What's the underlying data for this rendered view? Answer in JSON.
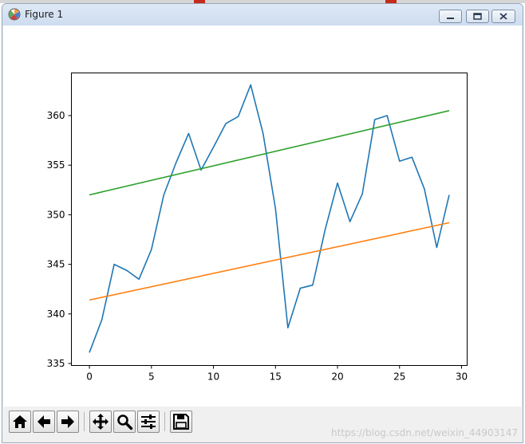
{
  "window": {
    "title": "Figure 1",
    "icon": "matplotlib-figure-icon",
    "controls": [
      {
        "name": "minimize-button",
        "icon": "minimize-icon"
      },
      {
        "name": "restore-button",
        "icon": "restore-icon"
      },
      {
        "name": "close-button",
        "icon": "close-icon"
      }
    ]
  },
  "toolbar": {
    "buttons": [
      {
        "name": "home-button",
        "icon": "home-icon"
      },
      {
        "name": "back-button",
        "icon": "arrow-left-icon"
      },
      {
        "name": "forward-button",
        "icon": "arrow-right-icon"
      },
      {
        "name": "pan-button",
        "icon": "move-icon"
      },
      {
        "name": "zoom-button",
        "icon": "magnifier-icon"
      },
      {
        "name": "configure-subplots-button",
        "icon": "sliders-icon"
      },
      {
        "name": "save-button",
        "icon": "floppy-disk-icon"
      }
    ],
    "watermark": "https://blog.csdn.net/weixin_44903147"
  },
  "colors": {
    "series_blue": "#1f77b4",
    "series_orange": "#ff7f0e",
    "series_green": "#2ca02c"
  },
  "chart_data": {
    "type": "line",
    "title": "",
    "xlabel": "",
    "ylabel": "",
    "xlim": [
      -1.45,
      30.45
    ],
    "ylim": [
      334.8,
      364.3
    ],
    "xticks": [
      0,
      5,
      10,
      15,
      20,
      25,
      30
    ],
    "yticks": [
      335,
      340,
      345,
      350,
      355,
      360
    ],
    "grid": false,
    "legend": "none",
    "series": [
      {
        "color": "#1f77b4",
        "x": [
          0,
          1,
          2,
          3,
          4,
          5,
          6,
          7,
          8,
          9,
          10,
          11,
          12,
          13,
          14,
          15,
          16,
          17,
          18,
          19,
          20,
          21,
          22,
          23,
          24,
          25,
          26,
          27,
          28,
          29
        ],
        "y": [
          336.1,
          339.4,
          345.0,
          344.4,
          343.5,
          346.5,
          352.0,
          355.3,
          358.2,
          354.5,
          356.8,
          359.2,
          359.9,
          363.1,
          358.2,
          350.6,
          338.6,
          342.6,
          342.9,
          348.5,
          353.2,
          349.3,
          352.1,
          359.6,
          360.0,
          355.4,
          355.8,
          352.6,
          346.7,
          352.0
        ]
      },
      {
        "color": "#ff7f0e",
        "x": [
          0,
          29
        ],
        "y": [
          341.4,
          349.2
        ]
      },
      {
        "color": "#2ca02c",
        "x": [
          0,
          29
        ],
        "y": [
          352.0,
          360.5
        ]
      }
    ]
  }
}
